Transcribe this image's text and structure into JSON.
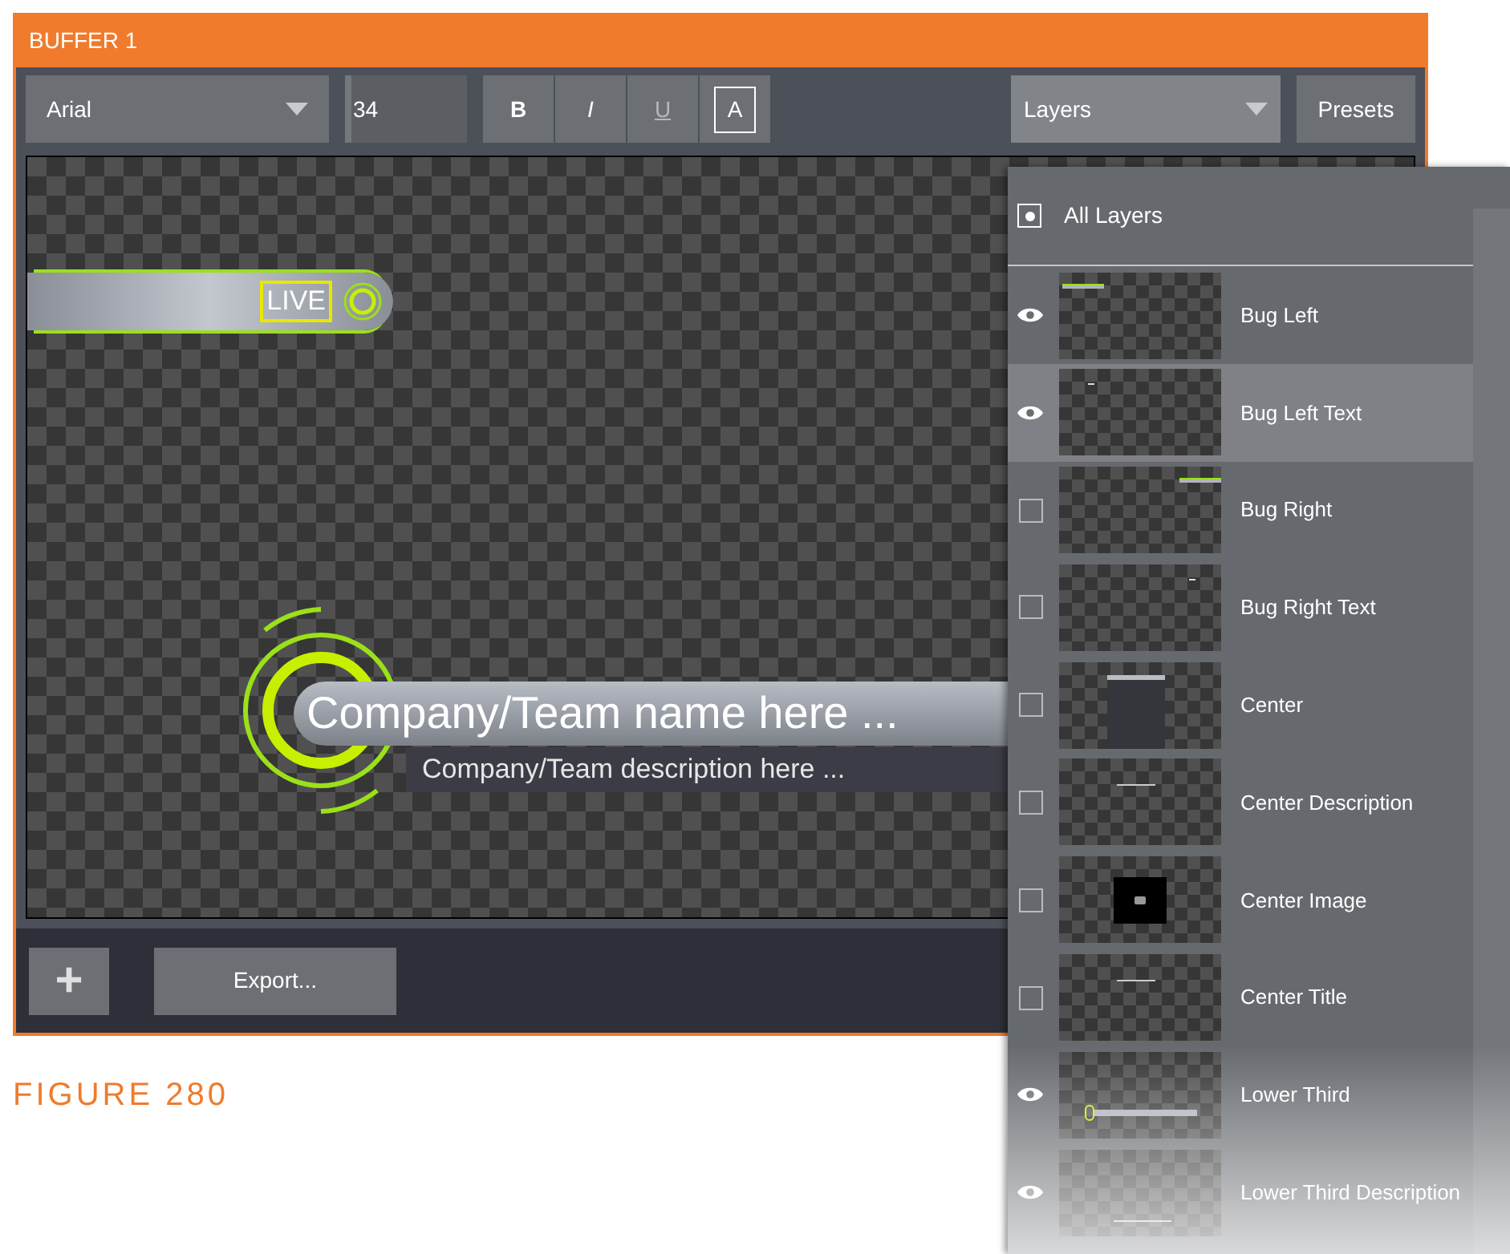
{
  "window": {
    "title": "BUFFER 1"
  },
  "toolbar": {
    "font": "Arial",
    "size": "34",
    "styles": [
      {
        "label": "B",
        "kind": "bold",
        "disabled": false,
        "selected": false
      },
      {
        "label": "I",
        "kind": "italic",
        "disabled": false,
        "selected": false
      },
      {
        "label": "U",
        "kind": "underline",
        "disabled": true,
        "selected": false
      },
      {
        "label": "A",
        "kind": "outline",
        "disabled": false,
        "selected": true
      }
    ],
    "layers_dropdown": "Layers",
    "presets": "Presets"
  },
  "canvas": {
    "bug_text": "LIVE",
    "lower_third_title": "Company/Team name here ...",
    "lower_third_description": "Company/Team description here ..."
  },
  "bottom_bar": {
    "add": "+",
    "export": "Export..."
  },
  "caption": "FIGURE 280",
  "layers_menu": {
    "all_layers": {
      "label": "All Layers",
      "checked": true
    },
    "items": [
      {
        "label": "Bug Left",
        "visible": true,
        "selected": false,
        "kind": "bug-left"
      },
      {
        "label": "Bug Left Text",
        "visible": true,
        "selected": true,
        "kind": "bug-left-text"
      },
      {
        "label": "Bug Right",
        "visible": false,
        "selected": false,
        "kind": "bug-right"
      },
      {
        "label": "Bug Right Text",
        "visible": false,
        "selected": false,
        "kind": "bug-right-text"
      },
      {
        "label": "Center",
        "visible": false,
        "selected": false,
        "kind": "center"
      },
      {
        "label": "Center Description",
        "visible": false,
        "selected": false,
        "kind": "center-line"
      },
      {
        "label": "Center Image",
        "visible": false,
        "selected": false,
        "kind": "center-image"
      },
      {
        "label": "Center Title",
        "visible": false,
        "selected": false,
        "kind": "center-line"
      },
      {
        "label": "Lower Third",
        "visible": true,
        "selected": false,
        "kind": "lower-third"
      },
      {
        "label": "Lower Third Description",
        "visible": true,
        "selected": false,
        "kind": "lower-third-description"
      }
    ]
  }
}
